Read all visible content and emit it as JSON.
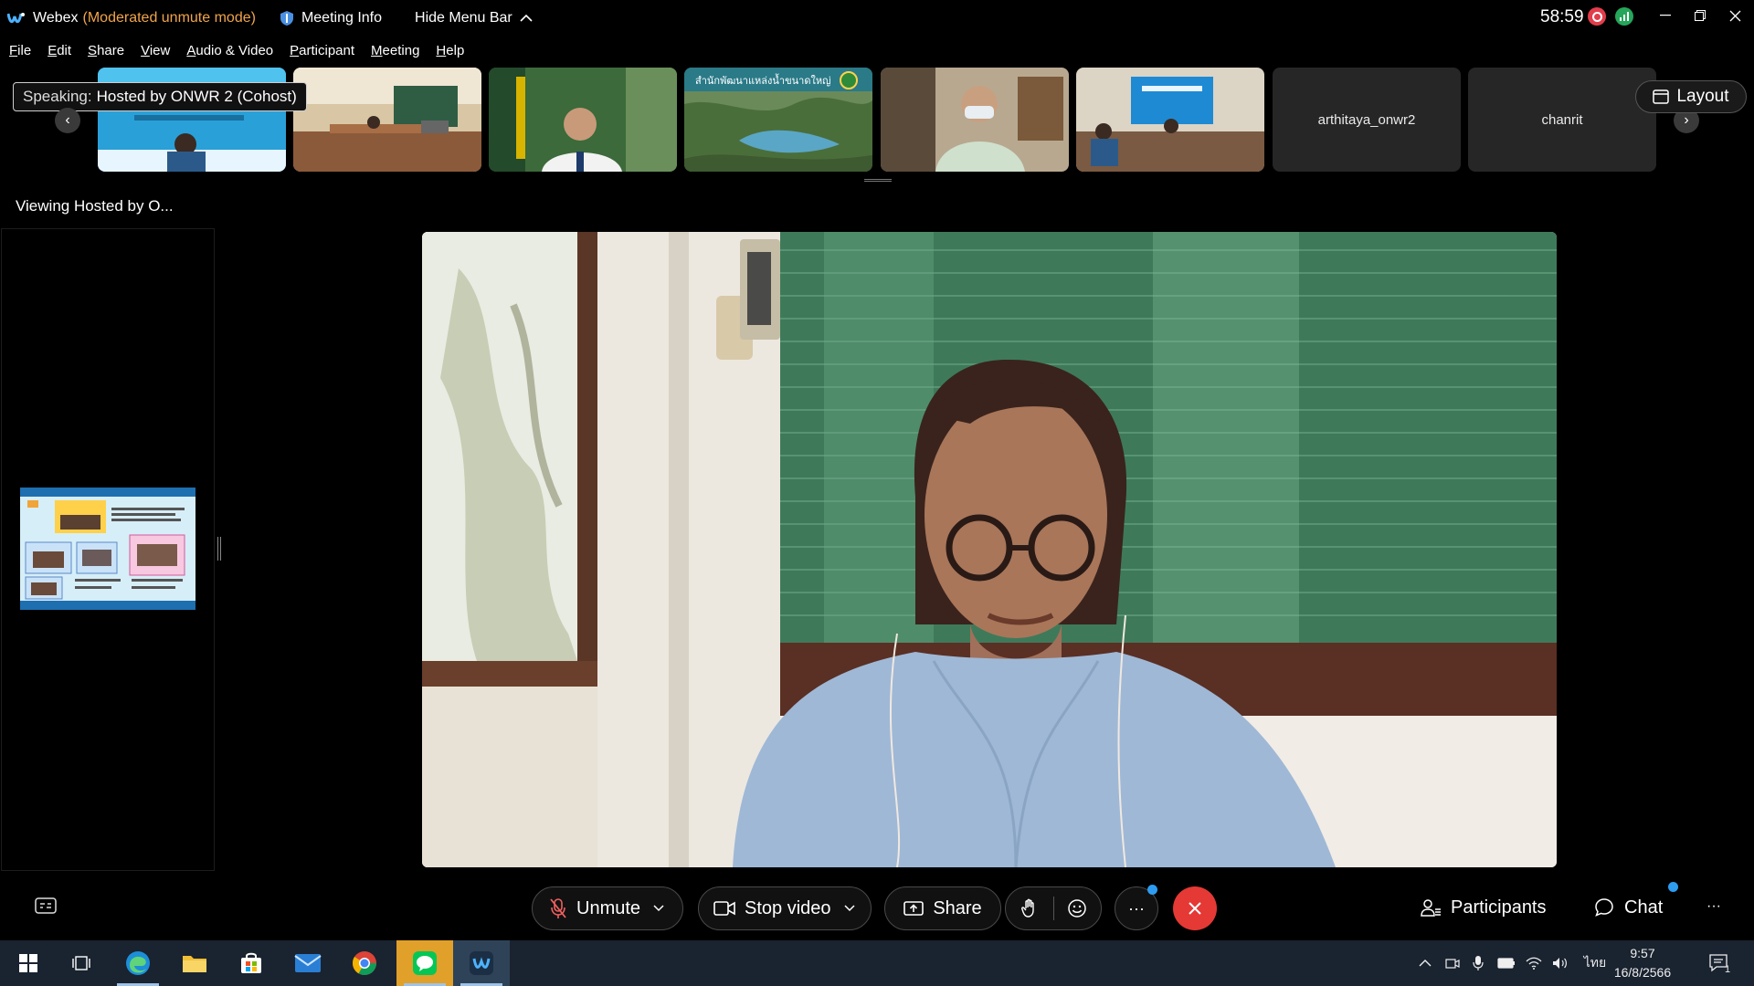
{
  "titlebar": {
    "app_name": "Webex",
    "mode": "(Moderated unmute mode)",
    "meeting_info": "Meeting Info",
    "hide_menu": "Hide Menu Bar",
    "timer": "58:59"
  },
  "menu": {
    "items": [
      {
        "u": "F",
        "rest": "ile"
      },
      {
        "u": "E",
        "rest": "dit"
      },
      {
        "u": "S",
        "rest": "hare"
      },
      {
        "u": "V",
        "rest": "iew"
      },
      {
        "u": "A",
        "rest": "udio & Video"
      },
      {
        "u": "P",
        "rest": "articipant"
      },
      {
        "u": "M",
        "rest": "eeting"
      },
      {
        "u": "H",
        "rest": "elp"
      }
    ]
  },
  "filmstrip": {
    "speaking_label": "Speaking:",
    "speaking_name": "Hosted by ONWR 2 (Cohost)",
    "prev": "‹",
    "next": "›",
    "dam_caption": "สำนักพัฒนาแหล่งน้ำขนาดใหญ่",
    "name_tiles": [
      "arthitaya_onwr2",
      "chanrit"
    ],
    "layout_label": "Layout"
  },
  "stage": {
    "viewing": "Viewing Hosted by O..."
  },
  "controls": {
    "unmute": "Unmute",
    "stop_video": "Stop video",
    "share": "Share",
    "more": "···",
    "participants": "Participants",
    "chat": "Chat",
    "overflow": "···"
  },
  "taskbar": {
    "lang": "ไทย",
    "time": "9:57",
    "date": "16/8/2566",
    "notif_count": "1"
  },
  "colors": {
    "mode": "#f0a44b",
    "end_call": "#e53935",
    "badge": "#2d9cf0",
    "taskbar": "#1a2330"
  }
}
